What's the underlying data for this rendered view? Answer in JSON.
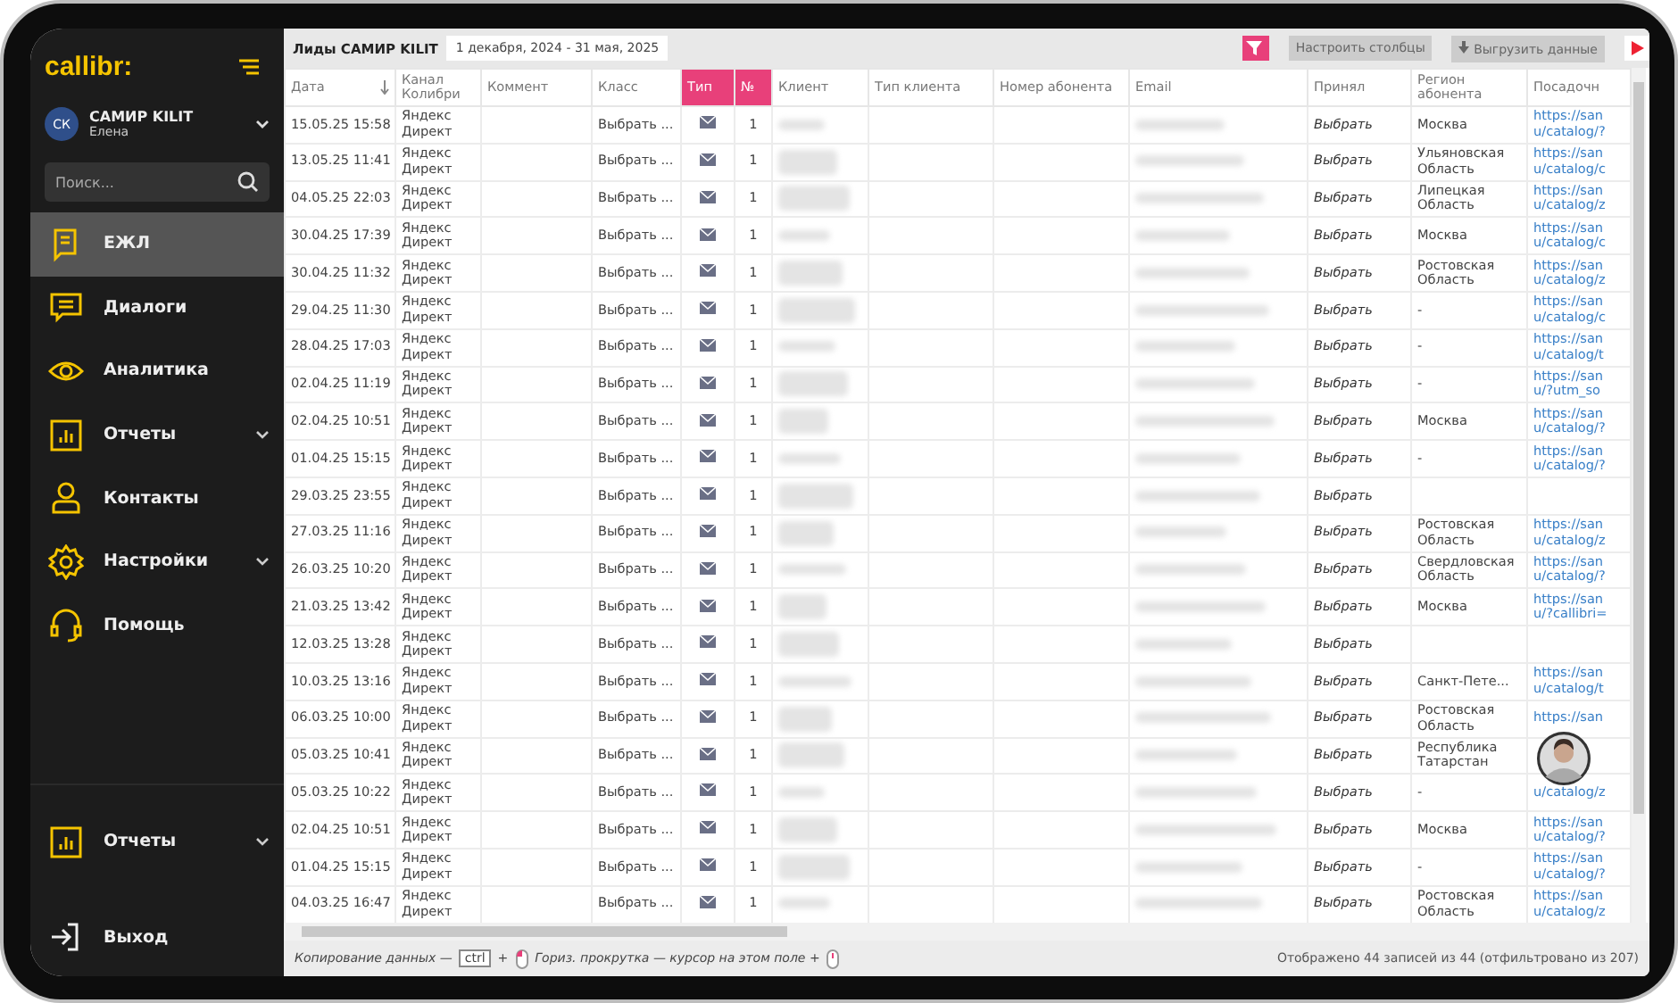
{
  "sidebar": {
    "logo": "callibr:",
    "profile": {
      "initials": "СК",
      "name": "САМИР KILIT",
      "subtitle": "Елена"
    },
    "search": {
      "placeholder": "Поиск..."
    },
    "items": [
      {
        "label": "ЕЖЛ",
        "kind": "doc",
        "selected": true,
        "submenu": false
      },
      {
        "label": "Диалоги",
        "kind": "chat",
        "selected": false,
        "submenu": false
      },
      {
        "label": "Аналитика",
        "kind": "eye",
        "selected": false,
        "submenu": false
      },
      {
        "label": "Отчеты",
        "kind": "chart",
        "selected": false,
        "submenu": true
      },
      {
        "label": "Контакты",
        "kind": "person",
        "selected": false,
        "submenu": false
      },
      {
        "label": "Настройки",
        "kind": "gear",
        "selected": false,
        "submenu": true
      },
      {
        "label": "Помощь",
        "kind": "headset",
        "selected": false,
        "submenu": false
      }
    ],
    "bottom_items": [
      {
        "label": "Отчеты",
        "kind": "chart",
        "selected": false,
        "submenu": true
      },
      {
        "label": "Выход",
        "kind": "exit",
        "selected": false,
        "submenu": false
      }
    ]
  },
  "toolbar": {
    "title": "Лиды САМИР KILIT",
    "date_range": "1 декабря, 2024 - 31 мая, 2025",
    "buttons": [
      "Настроить столбцы",
      "Выгрузить данные"
    ]
  },
  "table": {
    "columns": [
      {
        "label": "Дата",
        "highlighted": false,
        "sorted": true
      },
      {
        "label": "Канал Колибри",
        "highlighted": false,
        "sorted": false
      },
      {
        "label": "Коммент",
        "highlighted": false,
        "sorted": false
      },
      {
        "label": "Класс",
        "highlighted": false,
        "sorted": false
      },
      {
        "label": "Тип",
        "highlighted": true,
        "sorted": false
      },
      {
        "label": "№",
        "highlighted": true,
        "sorted": false
      },
      {
        "label": "Клиент",
        "highlighted": false,
        "sorted": false
      },
      {
        "label": "Тип клиента",
        "highlighted": false,
        "sorted": false
      },
      {
        "label": "Номер абонента",
        "highlighted": false,
        "sorted": false
      },
      {
        "label": "Email",
        "highlighted": false,
        "sorted": false
      },
      {
        "label": "Принял",
        "highlighted": false,
        "sorted": false
      },
      {
        "label": "Регион абонента",
        "highlighted": false,
        "sorted": false
      },
      {
        "label": "Посадочн",
        "highlighted": false,
        "sorted": false
      }
    ],
    "rows": [
      {
        "date": "15.05.25 15:58",
        "channel": "Яндекс Директ",
        "class": "Выбрать ...",
        "number": "1",
        "accepted": "Выбрать",
        "region": "Москва",
        "url": [
          "https://san",
          "u/catalog/?"
        ]
      },
      {
        "date": "13.05.25 11:41",
        "channel": "Яндекс Директ",
        "class": "Выбрать ...",
        "number": "1",
        "accepted": "Выбрать",
        "region": "Ульяновская Область",
        "url": [
          "https://san",
          "u/catalog/c"
        ]
      },
      {
        "date": "04.05.25 22:03",
        "channel": "Яндекс Директ",
        "class": "Выбрать ...",
        "number": "1",
        "accepted": "Выбрать",
        "region": "Липецкая Область",
        "url": [
          "https://san",
          "u/catalog/z"
        ]
      },
      {
        "date": "30.04.25 17:39",
        "channel": "Яндекс Директ",
        "class": "Выбрать ...",
        "number": "1",
        "accepted": "Выбрать",
        "region": "Москва",
        "url": [
          "https://san",
          "u/catalog/c"
        ]
      },
      {
        "date": "30.04.25 11:32",
        "channel": "Яндекс Директ",
        "class": "Выбрать ...",
        "number": "1",
        "accepted": "Выбрать",
        "region": "Ростовская Область",
        "url": [
          "https://san",
          "u/catalog/z"
        ]
      },
      {
        "date": "29.04.25 11:30",
        "channel": "Яндекс Директ",
        "class": "Выбрать ...",
        "number": "1",
        "accepted": "Выбрать",
        "region": "-",
        "url": [
          "https://san",
          "u/catalog/c"
        ]
      },
      {
        "date": "28.04.25 17:03",
        "channel": "Яндекс Директ",
        "class": "Выбрать ...",
        "number": "1",
        "accepted": "Выбрать",
        "region": "-",
        "url": [
          "https://san",
          "u/catalog/t"
        ]
      },
      {
        "date": "02.04.25 11:19",
        "channel": "Яндекс Директ",
        "class": "Выбрать ...",
        "number": "1",
        "accepted": "Выбрать",
        "region": "-",
        "url": [
          "https://san",
          "u/?utm_so"
        ]
      },
      {
        "date": "02.04.25 10:51",
        "channel": "Яндекс Директ",
        "class": "Выбрать ...",
        "number": "1",
        "accepted": "Выбрать",
        "region": "Москва",
        "url": [
          "https://san",
          "u/catalog/?"
        ]
      },
      {
        "date": "01.04.25 15:15",
        "channel": "Яндекс Директ",
        "class": "Выбрать ...",
        "number": "1",
        "accepted": "Выбрать",
        "region": "-",
        "url": [
          "https://san",
          "u/catalog/?"
        ]
      },
      {
        "date": "29.03.25 23:55",
        "channel": "Яндекс Директ",
        "class": "Выбрать ...",
        "number": "1",
        "accepted": "Выбрать"
      },
      {
        "date": "27.03.25 11:16",
        "channel": "Яндекс Директ",
        "class": "Выбрать ...",
        "number": "1",
        "accepted": "Выбрать",
        "region": "Ростовская Область",
        "url": [
          "https://san",
          "u/catalog/z"
        ]
      },
      {
        "date": "26.03.25 10:20",
        "channel": "Яндекс Директ",
        "class": "Выбрать ...",
        "number": "1",
        "accepted": "Выбрать",
        "region": "Свердловская Область",
        "url": [
          "https://san",
          "u/catalog/?"
        ]
      },
      {
        "date": "21.03.25 13:42",
        "channel": "Яндекс Директ",
        "class": "Выбрать ...",
        "number": "1",
        "accepted": "Выбрать",
        "region": "Москва",
        "url": [
          "https://san",
          "u/?callibri="
        ]
      },
      {
        "date": "12.03.25 13:28",
        "channel": "Яндекс Директ",
        "class": "Выбрать ...",
        "number": "1",
        "accepted": "Выбрать"
      },
      {
        "date": "10.03.25 13:16",
        "channel": "Яндекс Директ",
        "class": "Выбрать ...",
        "number": "1",
        "accepted": "Выбрать",
        "region": "Санкт-Пете...",
        "url": [
          "https://san",
          "u/catalog/t"
        ]
      },
      {
        "date": "06.03.25 10:00",
        "channel": "Яндекс Директ",
        "class": "Выбрать ...",
        "number": "1",
        "accepted": "Выбрать",
        "region": "Ростовская Область",
        "url": [
          "https://san"
        ]
      },
      {
        "date": "05.03.25 10:41",
        "channel": "Яндекс Директ",
        "class": "Выбрать ...",
        "number": "1",
        "accepted": "Выбрать",
        "region": "Республика Татарстан"
      },
      {
        "date": "05.03.25 10:22",
        "channel": "Яндекс Директ",
        "class": "Выбрать ...",
        "number": "1",
        "accepted": "Выбрать",
        "region": "-",
        "url": [
          "u/catalog/z"
        ]
      },
      {
        "date": "02.04.25 10:51",
        "channel": "Яндекс Директ",
        "class": "Выбрать ...",
        "number": "1",
        "accepted": "Выбрать",
        "region": "Москва",
        "url": [
          "https://san",
          "u/catalog/?"
        ]
      },
      {
        "date": "01.04.25 15:15",
        "channel": "Яндекс Директ",
        "class": "Выбрать ...",
        "number": "1",
        "accepted": "Выбрать",
        "region": "-",
        "url": [
          "https://san",
          "u/catalog/?"
        ]
      },
      {
        "date": "04.03.25 16:47",
        "channel": "Яндекс Директ",
        "class": "Выбрать ...",
        "number": "1",
        "accepted": "Выбрать",
        "region": "Ростовская Область",
        "url": [
          "https://san",
          "u/catalog/z"
        ]
      }
    ]
  },
  "footer": {
    "copy_hint": "Копирование данных —",
    "key": "ctrl",
    "plus": "+",
    "scroll_hint": "Гориз. прокрутка — курсор на этом поле +",
    "summary": "Отображено 44 записей из 44 (отфильтровано из 207)"
  }
}
